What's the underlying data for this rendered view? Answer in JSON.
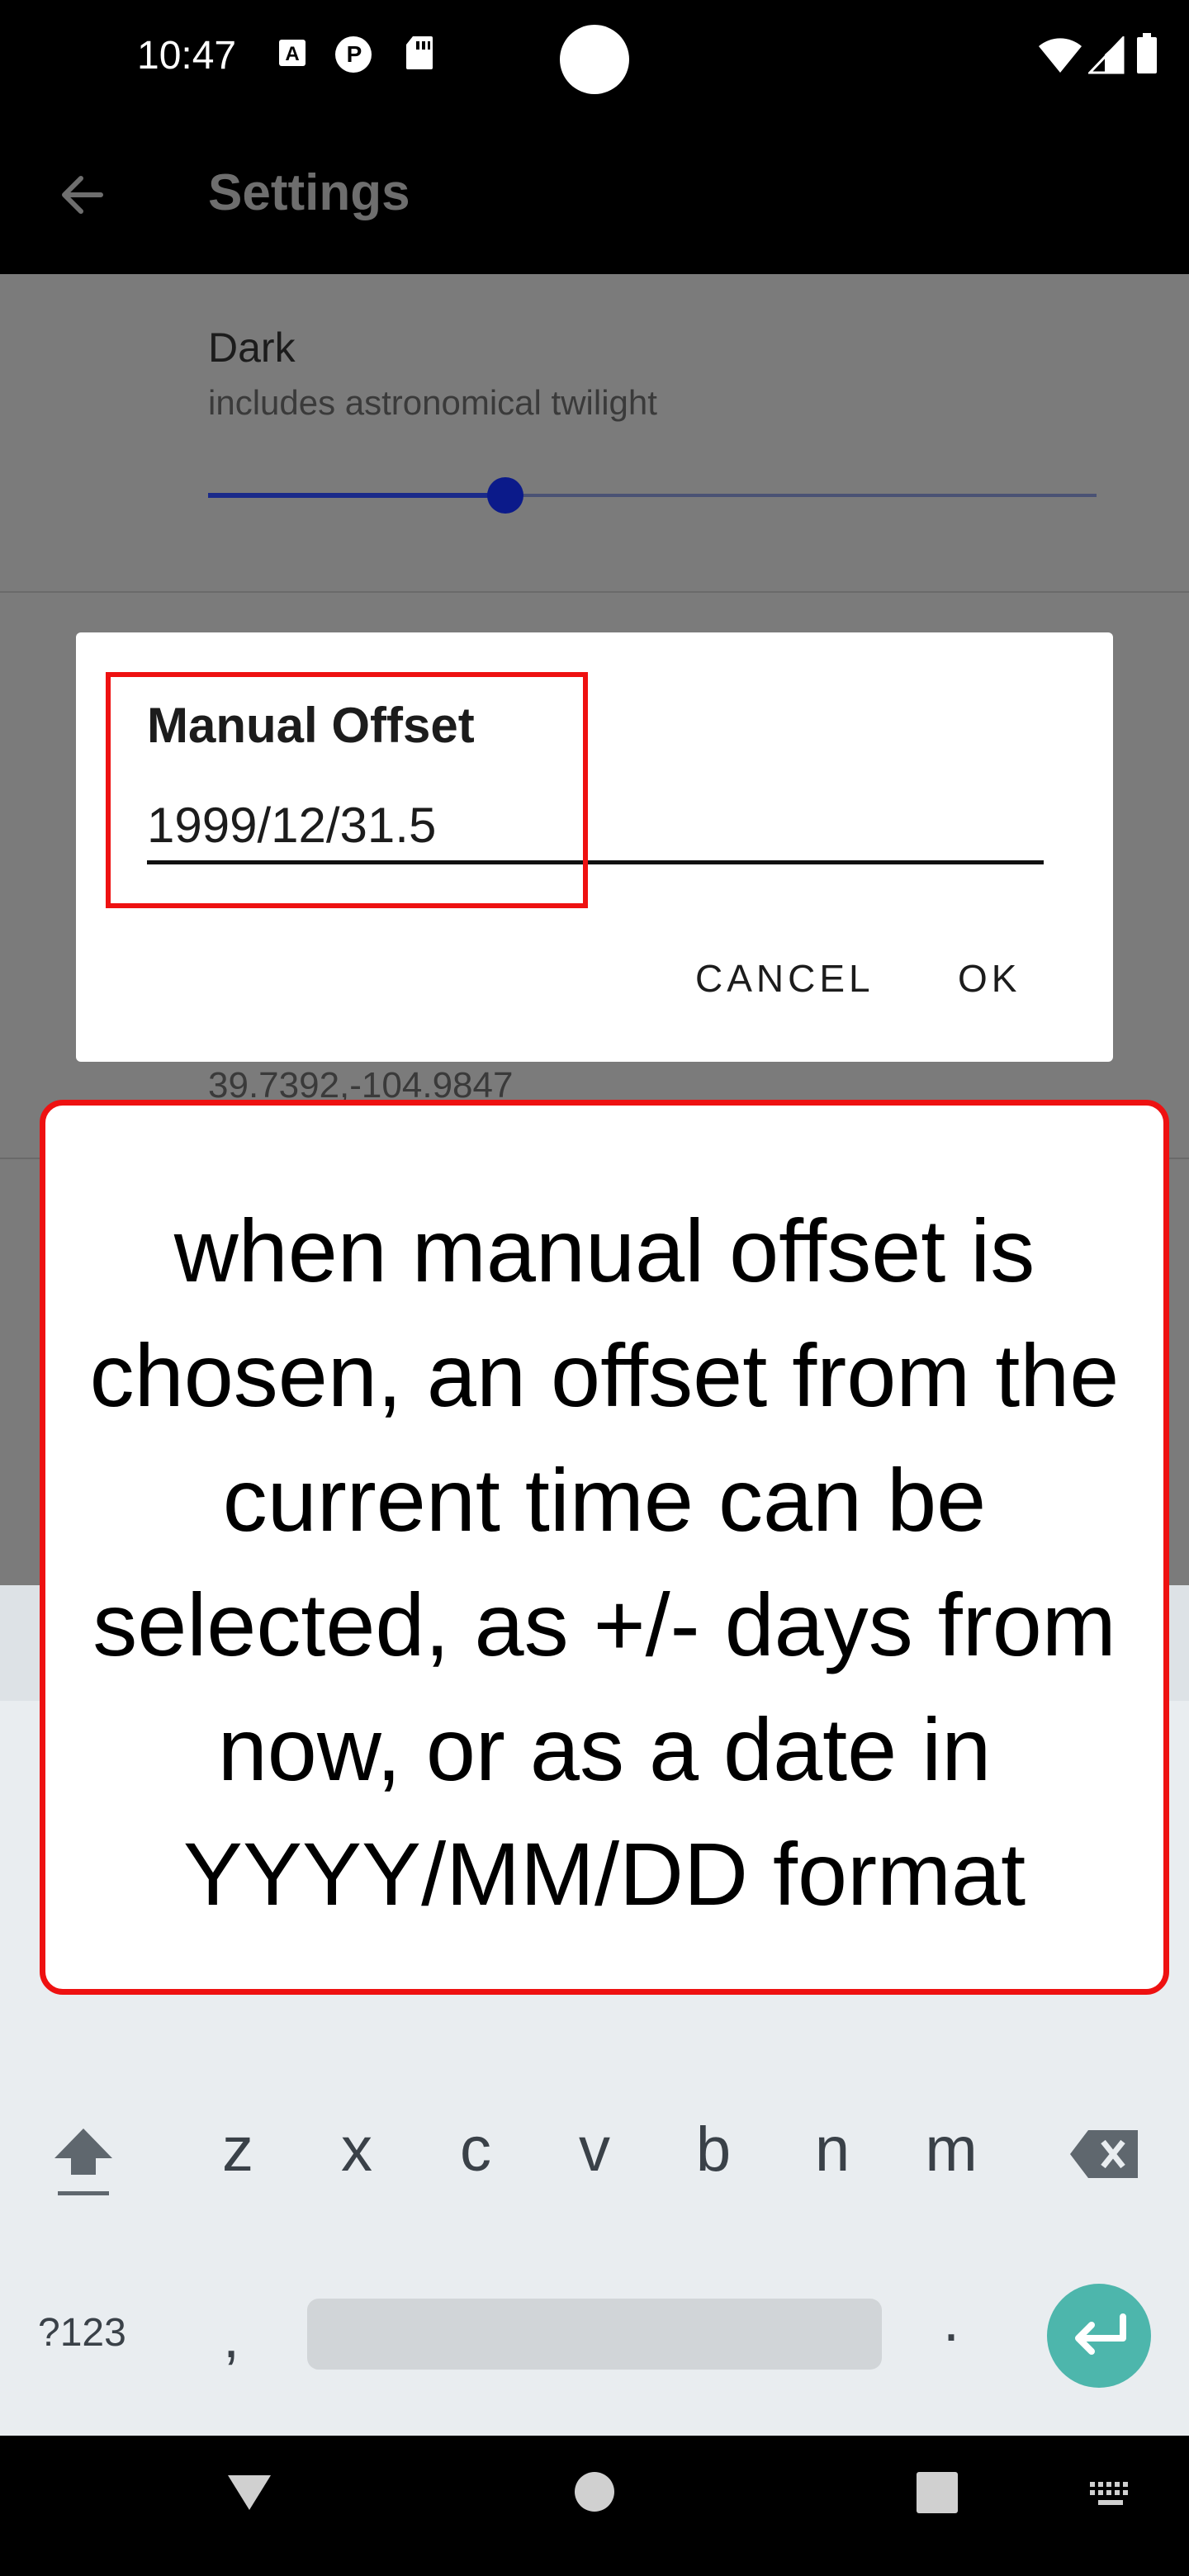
{
  "status_bar": {
    "time": "10:47",
    "icons": [
      "a-font-icon",
      "p-badge-icon",
      "sd-card-icon",
      "wifi-icon",
      "signal-icon",
      "battery-icon"
    ]
  },
  "app_bar": {
    "title": "Settings",
    "back_icon": "arrow-back-icon"
  },
  "settings": {
    "theme_title": "Dark",
    "theme_summary": "includes astronomical twilight",
    "slider_level": 0.33,
    "location_value": "39.7392,-104.9847"
  },
  "dialog": {
    "title": "Manual Offset",
    "input_value": "1999/12/31.5",
    "cancel_label": "CANCEL",
    "ok_label": "OK"
  },
  "annotation": {
    "text": "when manual offset is chosen, an offset from the current time can be selected, as +/- days from now, or as a date in YYYY/MM/DD format"
  },
  "keyboard": {
    "row3": [
      "z",
      "x",
      "c",
      "v",
      "b",
      "n",
      "m"
    ],
    "symbols_label": "?123",
    "comma": ",",
    "period": "."
  },
  "colors": {
    "highlight": "#ee1111",
    "slider": "#0b1a8a",
    "enter": "#4db6ac"
  }
}
